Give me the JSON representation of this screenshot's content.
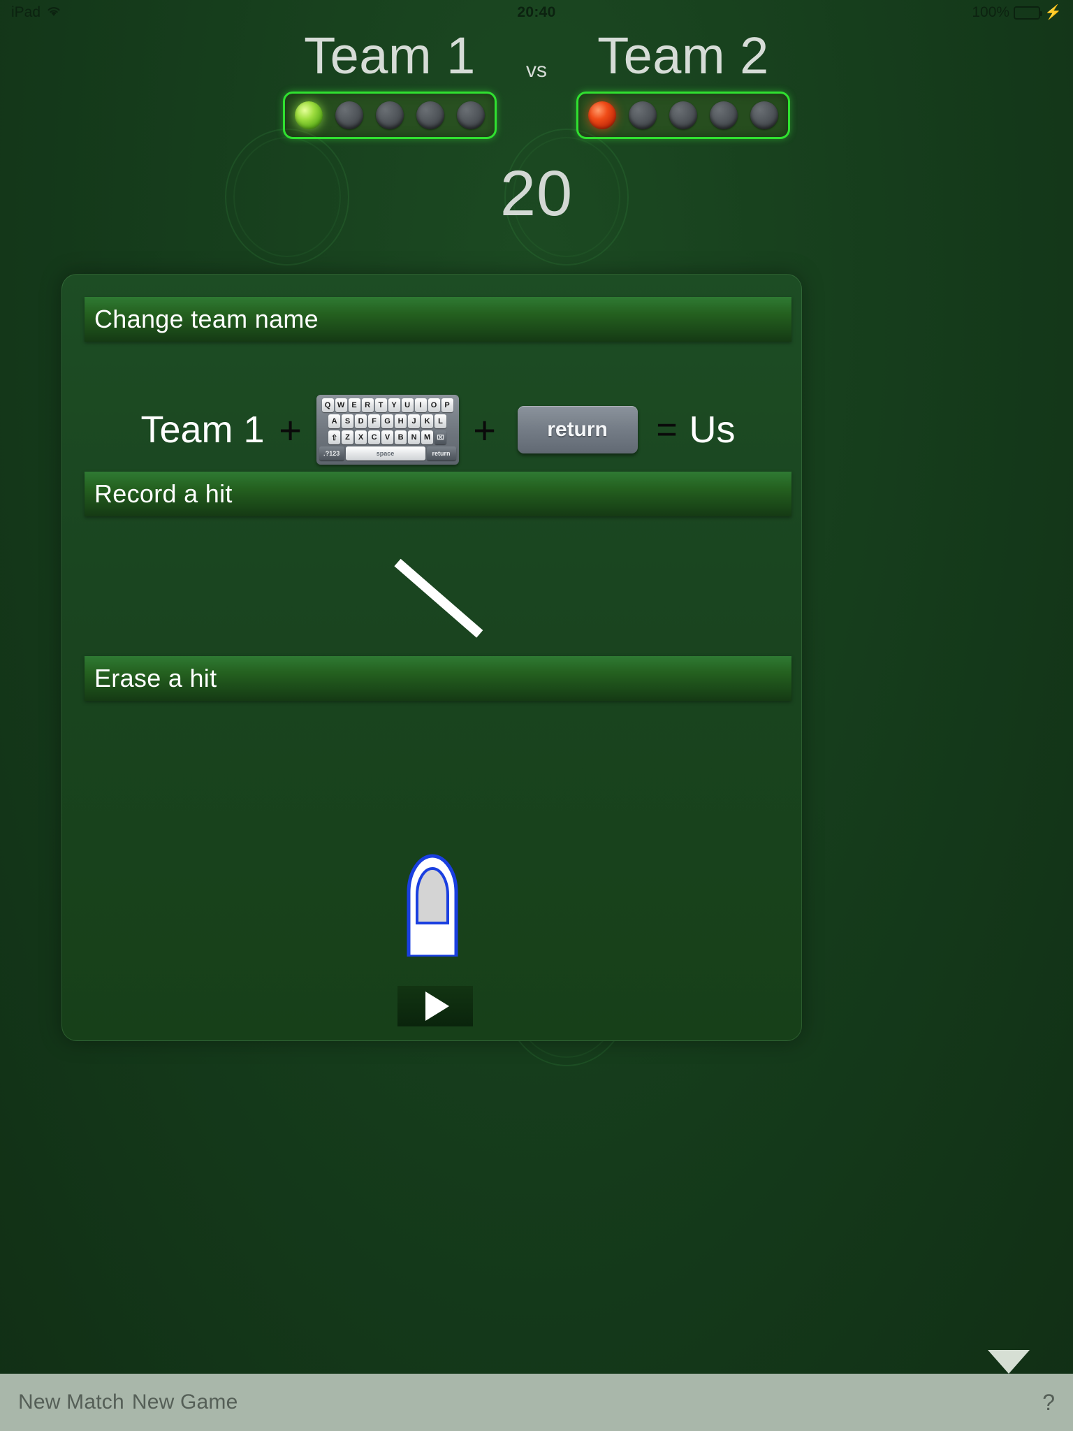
{
  "status_bar": {
    "device": "iPad",
    "wifi_icon": "wifi-icon",
    "time": "20:40",
    "battery_percent": "100%",
    "charging_icon": "lightning-bolt-icon",
    "battery_color": "#4cd964"
  },
  "scoreboard": {
    "team1": {
      "name": "Team 1",
      "leds": [
        "on",
        "off",
        "off",
        "off",
        "off"
      ],
      "led_color": "#9ede3f"
    },
    "vs_label": "vs",
    "team2": {
      "name": "Team 2",
      "leds": [
        "on",
        "off",
        "off",
        "off",
        "off"
      ],
      "led_color": "#f04c18"
    },
    "score": "20",
    "border_color": "#30e030"
  },
  "help_panel": {
    "sections": [
      {
        "title": "Change team name"
      },
      {
        "title": "Record a hit"
      },
      {
        "title": "Erase a hit"
      }
    ],
    "change_name_equation": {
      "team_label": "Team 1",
      "plus_1": "+",
      "keyboard_icon": "onscreen-keyboard-icon",
      "plus_2": "+",
      "return_key_label": "return",
      "equals": "=",
      "result_label": "Us"
    },
    "keyboard": {
      "row1": [
        "Q",
        "W",
        "E",
        "R",
        "T",
        "Y",
        "U",
        "I",
        "O",
        "P"
      ],
      "row2": [
        "A",
        "S",
        "D",
        "F",
        "G",
        "H",
        "J",
        "K",
        "L"
      ],
      "row3": [
        "⇧",
        "Z",
        "X",
        "C",
        "V",
        "B",
        "N",
        "M",
        "⌧"
      ],
      "row4": [
        "․?123",
        "space",
        "return"
      ]
    },
    "record_hit": {
      "gesture_icon": "swipe-stroke-icon"
    },
    "erase_hit": {
      "gesture_icon": "fingertip-tap-icon",
      "play_button_icon": "play-triangle-icon"
    }
  },
  "toolbar": {
    "new_match_label": "New Match",
    "new_game_label": "New Game",
    "help_label": "?"
  }
}
